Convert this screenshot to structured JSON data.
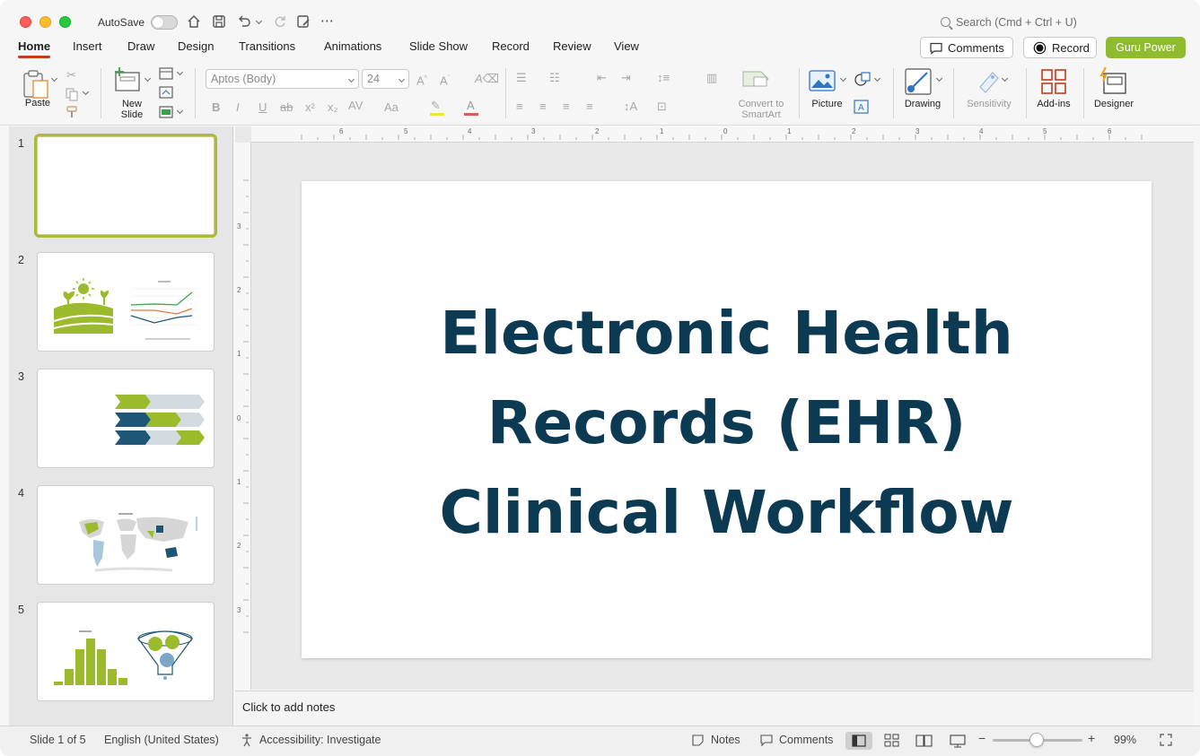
{
  "titlebar": {
    "autosave_label": "AutoSave",
    "search_placeholder": "Search (Cmd + Ctrl + U)"
  },
  "menu": {
    "tabs": [
      "Home",
      "Insert",
      "Draw",
      "Design",
      "Transitions",
      "Animations",
      "Slide Show",
      "Record",
      "Review",
      "View"
    ],
    "active_tab": "Home",
    "comments_label": "Comments",
    "record_label": "Record",
    "guru_label": "Guru Power"
  },
  "ribbon": {
    "paste_label": "Paste",
    "new_slide_label": "New\nSlide",
    "font_name": "Aptos (Body)",
    "font_size": "24",
    "convert_label": "Convert to\nSmartArt",
    "picture_label": "Picture",
    "drawing_label": "Drawing",
    "sensitivity_label": "Sensitivity",
    "addins_label": "Add-ins",
    "designer_label": "Designer"
  },
  "thumbnails": [
    "1",
    "2",
    "3",
    "4",
    "5"
  ],
  "slide": {
    "title_lines": [
      "Electronic Health",
      "Records (EHR)",
      "Clinical Workflow"
    ]
  },
  "notes": {
    "placeholder": "Click to add notes"
  },
  "status": {
    "slide_counter": "Slide 1 of 5",
    "language": "English (United States)",
    "accessibility": "Accessibility: Investigate",
    "notes_label": "Notes",
    "comments_label": "Comments",
    "zoom": "99%"
  },
  "colors": {
    "accent_tab": "#c43e1c",
    "guru": "#8fbc2f",
    "title_text": "#0c3a52",
    "thumb_green": "#9bbb2c",
    "thumb_navy": "#1d5676"
  }
}
